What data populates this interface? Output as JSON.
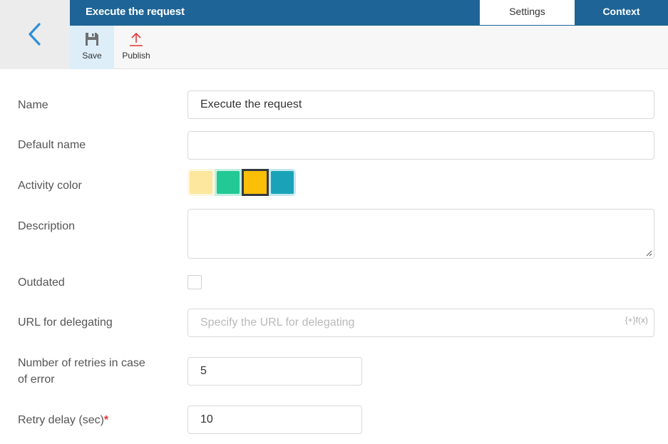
{
  "header": {
    "title": "Execute the request",
    "back_icon": "chevron-left-icon",
    "tabs": [
      {
        "label": "Settings",
        "active": true
      },
      {
        "label": "Context",
        "active": false
      }
    ]
  },
  "toolbar": {
    "save_label": "Save",
    "save_icon": "floppy-disk-icon",
    "publish_label": "Publish",
    "publish_icon": "upload-arrow-icon"
  },
  "form": {
    "name": {
      "label": "Name",
      "value": "Execute the request"
    },
    "default_name": {
      "label": "Default name",
      "value": ""
    },
    "activity_color": {
      "label": "Activity color",
      "options": [
        "#fde79e",
        "#22c995",
        "#fcbf07",
        "#1aa3b8"
      ],
      "selected_index": 2
    },
    "description": {
      "label": "Description",
      "value": ""
    },
    "outdated": {
      "label": "Outdated",
      "checked": false
    },
    "url_delegating": {
      "label": "URL for delegating",
      "placeholder": "Specify the URL for delegating",
      "value": "",
      "fx_label": "{+}f(x)"
    },
    "retries": {
      "label_line1": "Number of retries in case",
      "label_line2": "of error",
      "value": "5"
    },
    "retry_delay": {
      "label": "Retry delay (sec)",
      "required_mark": "*",
      "value": "10"
    }
  }
}
